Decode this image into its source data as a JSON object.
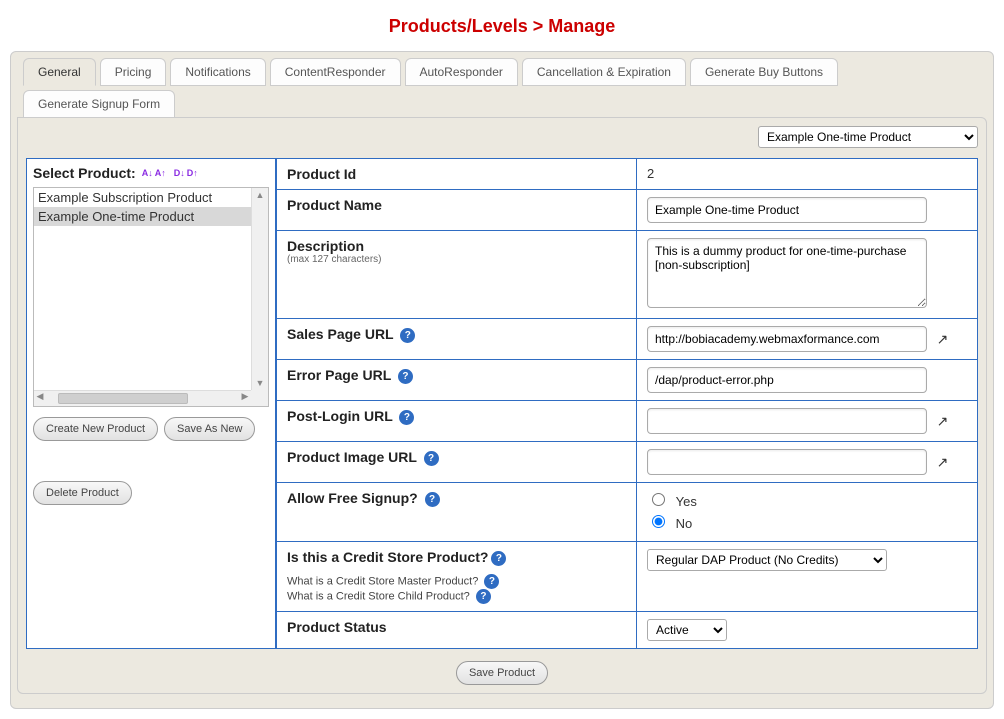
{
  "page_title": "Products/Levels > Manage",
  "tabs": [
    "General",
    "Pricing",
    "Notifications",
    "ContentResponder",
    "AutoResponder",
    "Cancellation & Expiration",
    "Generate Buy Buttons",
    "Generate Signup Form"
  ],
  "active_tab_index": 0,
  "top_select_value": "Example One-time Product",
  "sidebar": {
    "header": "Select Product:",
    "products": [
      "Example Subscription Product",
      "Example One-time Product"
    ],
    "selected_index": 1,
    "buttons": {
      "create": "Create New Product",
      "save_as_new": "Save As New",
      "delete": "Delete Product"
    }
  },
  "form": {
    "product_id": {
      "label": "Product Id",
      "value": "2"
    },
    "product_name": {
      "label": "Product Name",
      "value": "Example One-time Product"
    },
    "description": {
      "label": "Description",
      "sublabel": "(max 127 characters)",
      "value": "This is a dummy product for one-time-purchase [non-subscription]"
    },
    "sales_page_url": {
      "label": "Sales Page URL",
      "value": "http://bobiacademy.webmaxformance.com"
    },
    "error_page_url": {
      "label": "Error Page URL",
      "value": "/dap/product-error.php"
    },
    "post_login_url": {
      "label": "Post-Login URL",
      "value": ""
    },
    "product_image_url": {
      "label": "Product Image URL",
      "value": ""
    },
    "allow_free_signup": {
      "label": "Allow Free Signup?",
      "options": [
        "Yes",
        "No"
      ],
      "selected": "No"
    },
    "credit_store": {
      "label": "Is this a Credit Store Product?",
      "help1": "What is a Credit Store Master Product?",
      "help2": "What is a Credit Store Child Product?",
      "selected": "Regular DAP Product (No Credits)"
    },
    "product_status": {
      "label": "Product Status",
      "selected": "Active"
    }
  },
  "footer": {
    "save_button": "Save Product"
  }
}
